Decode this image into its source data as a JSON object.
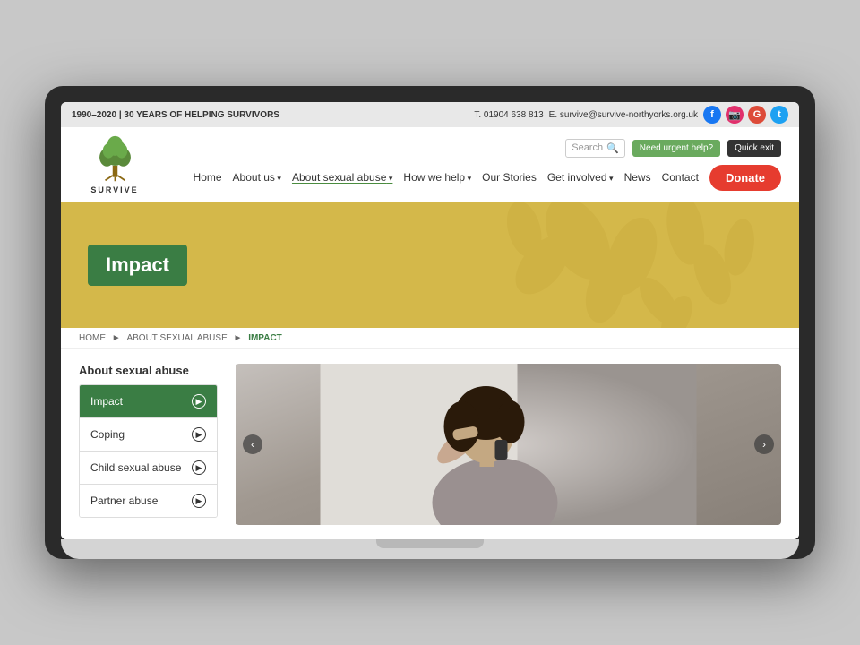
{
  "topbar": {
    "left": "1990–2020 | 30 YEARS OF HELPING SURVIVORS",
    "phone": "T. 01904 638 813",
    "email": "E. survive@survive-northyorks.org.uk",
    "socials": [
      {
        "name": "facebook",
        "label": "f",
        "class": "fb"
      },
      {
        "name": "instagram",
        "label": "📷",
        "class": "ig"
      },
      {
        "name": "google-plus",
        "label": "G",
        "class": "gp"
      },
      {
        "name": "twitter",
        "label": "t",
        "class": "tw"
      }
    ]
  },
  "header": {
    "logo_text": "SURVIVE",
    "search_placeholder": "Search",
    "urgent_label": "Need urgent help?",
    "quick_exit_label": "Quick exit",
    "donate_label": "Donate"
  },
  "nav": {
    "items": [
      {
        "label": "Home",
        "has_dropdown": false
      },
      {
        "label": "About us",
        "has_dropdown": true
      },
      {
        "label": "About sexual abuse",
        "has_dropdown": true,
        "underline": true
      },
      {
        "label": "How we help",
        "has_dropdown": true
      },
      {
        "label": "Our Stories",
        "has_dropdown": false
      },
      {
        "label": "Get involved",
        "has_dropdown": true
      },
      {
        "label": "News",
        "has_dropdown": false
      },
      {
        "label": "Contact",
        "has_dropdown": false
      }
    ]
  },
  "hero": {
    "title": "Impact"
  },
  "breadcrumb": {
    "items": [
      {
        "label": "HOME",
        "link": true
      },
      {
        "label": "ABOUT SEXUAL ABUSE",
        "link": true
      },
      {
        "label": "IMPACT",
        "current": true
      }
    ]
  },
  "sidebar": {
    "title": "About sexual abuse",
    "items": [
      {
        "label": "Impact",
        "active": true
      },
      {
        "label": "Coping",
        "active": false
      },
      {
        "label": "Child sexual abuse",
        "active": false
      },
      {
        "label": "Partner abuse",
        "active": false
      }
    ]
  },
  "slider": {
    "prev_label": "‹",
    "next_label": "›"
  }
}
